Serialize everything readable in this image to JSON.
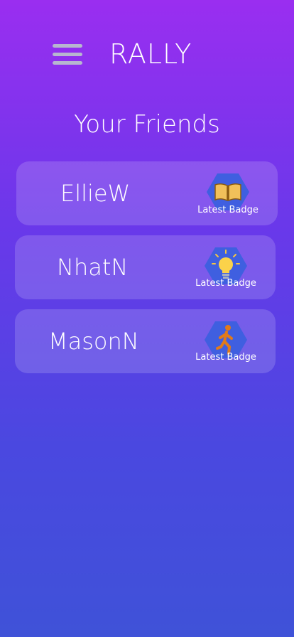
{
  "header": {
    "title": "RALLY"
  },
  "section": {
    "title": "Your Friends"
  },
  "friends": [
    {
      "name": "EllieW",
      "badge_label": "Latest Badge",
      "badge_icon": "book-icon"
    },
    {
      "name": "NhatN",
      "badge_label": "Latest Badge",
      "badge_icon": "lightbulb-icon"
    },
    {
      "name": "MasonN",
      "badge_label": "Latest Badge",
      "badge_icon": "running-person-icon"
    }
  ],
  "colors": {
    "gradient_top": "#9a2ef0",
    "gradient_bottom": "#3f52d8",
    "badge_hex": "#3f5fe0",
    "menu_icon": "#b7b7cf"
  }
}
